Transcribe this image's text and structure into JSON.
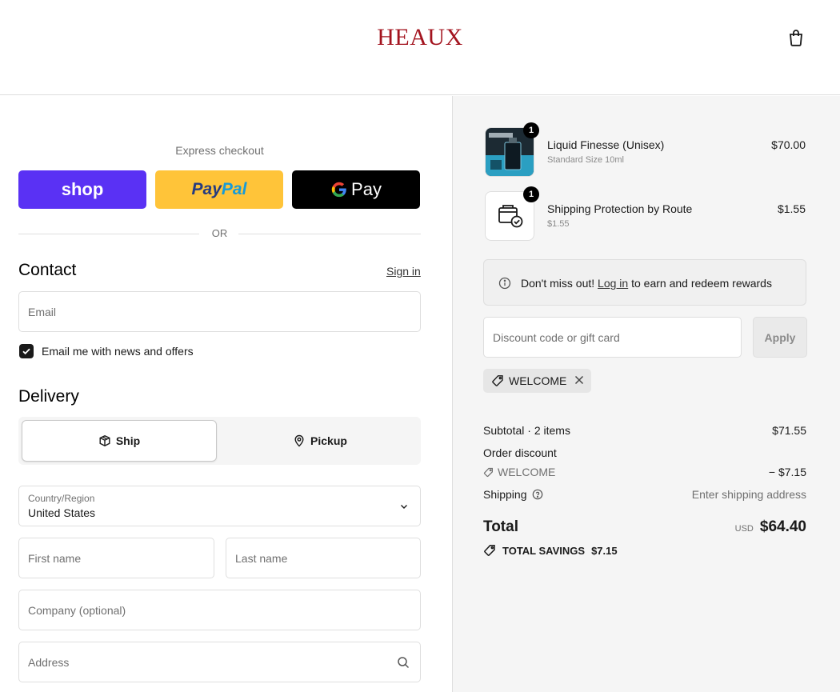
{
  "header": {
    "logo": "HEAUX",
    "cart_icon": "shopping-bag-icon"
  },
  "express": {
    "label": "Express checkout",
    "shop_label": "shop",
    "paypal_part1": "Pay",
    "paypal_part2": "Pal",
    "gpay_label": "Pay",
    "or_label": "OR"
  },
  "contact": {
    "title": "Contact",
    "sign_in": "Sign in",
    "email_placeholder": "Email",
    "newsletter_label": "Email me with news and offers",
    "newsletter_checked": true
  },
  "delivery": {
    "title": "Delivery",
    "ship_label": "Ship",
    "pickup_label": "Pickup",
    "country_label": "Country/Region",
    "country_value": "United States",
    "first_name_placeholder": "First name",
    "last_name_placeholder": "Last name",
    "company_placeholder": "Company (optional)",
    "address_placeholder": "Address"
  },
  "cart": {
    "items": [
      {
        "name": "Liquid Finesse (Unisex)",
        "variant": "Standard Size 10ml",
        "price": "$70.00",
        "quantity": "1"
      },
      {
        "name": "Shipping Protection by Route",
        "variant": "$1.55",
        "price": "$1.55",
        "quantity": "1"
      }
    ],
    "rewards_prefix": "Don't miss out! ",
    "rewards_link": "Log in",
    "rewards_suffix": " to earn and redeem rewards",
    "discount_placeholder": "Discount code or gift card",
    "apply_label": "Apply",
    "applied_code": "WELCOME"
  },
  "summary": {
    "subtotal_label": "Subtotal · 2 items",
    "subtotal_value": "$71.55",
    "order_discount_label": "Order discount",
    "discount_code": "WELCOME",
    "discount_value": "− $7.15",
    "shipping_label": "Shipping",
    "shipping_value": "Enter shipping address",
    "total_label": "Total",
    "currency": "USD",
    "total_value": "$64.40",
    "savings_label": "TOTAL SAVINGS",
    "savings_value": "$7.15"
  },
  "colors": {
    "brand": "#a3141f",
    "shop_pay": "#5a31f4",
    "paypal": "#ffc439",
    "gpay": "#000000"
  }
}
